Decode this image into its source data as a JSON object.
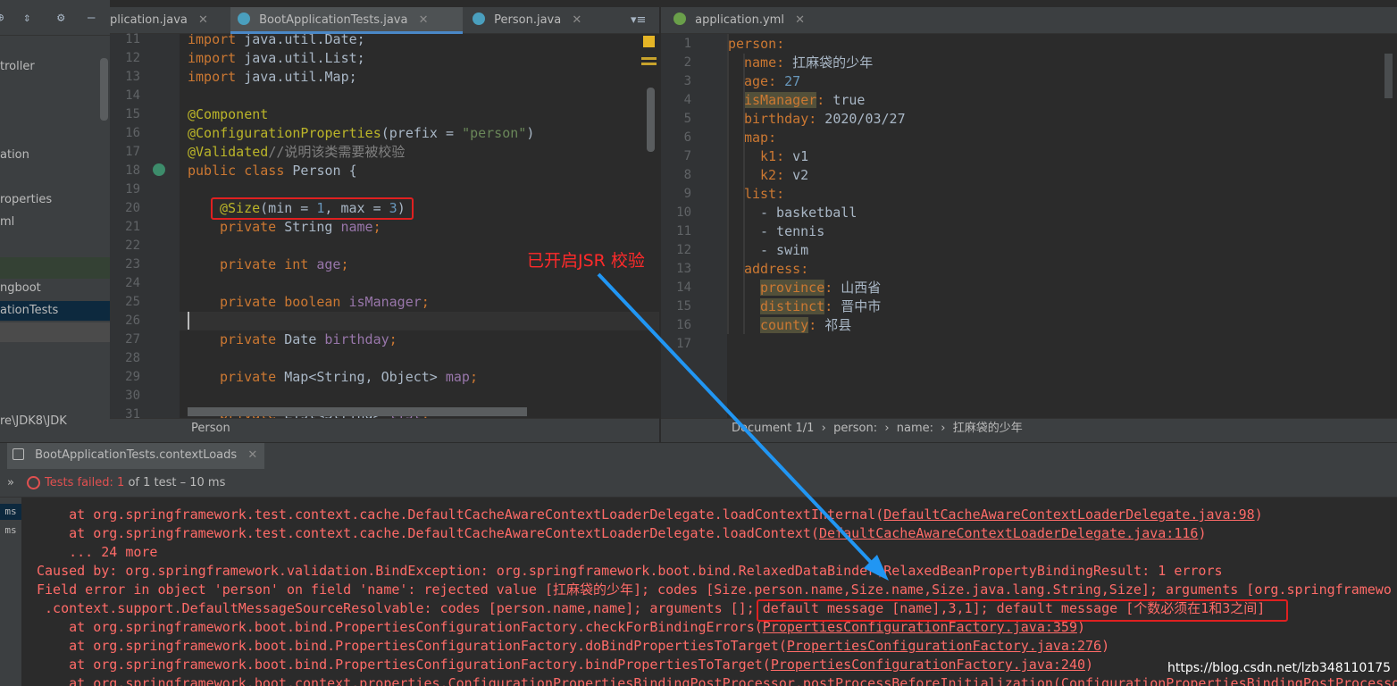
{
  "sidebar": {
    "items": [
      {
        "label": "troller"
      },
      {
        "label": "ation"
      },
      {
        "label": "roperties"
      },
      {
        "label": "ml"
      },
      {
        "label": "ngboot"
      },
      {
        "label": "ationTests"
      },
      {
        "label": "re\\JDK8\\JDK"
      }
    ]
  },
  "java_tabs": [
    {
      "label": "plication.java",
      "close": "✕"
    },
    {
      "label": "BootApplicationTests.java",
      "close": "✕"
    },
    {
      "label": "Person.java",
      "close": "✕"
    }
  ],
  "yml_tab": {
    "label": "application.yml",
    "close": "✕"
  },
  "java_lines": {
    "numbers": [
      "11",
      "12",
      "13",
      "14",
      "15",
      "16",
      "17",
      "18",
      "19",
      "20",
      "21",
      "22",
      "23",
      "24",
      "25",
      "26",
      "27",
      "28",
      "29",
      "30",
      "31"
    ]
  },
  "java_code": {
    "l11a": "import",
    "l11b": " java.util.Date;",
    "l12a": "import",
    "l12b": " java.util.List;",
    "l13a": "import",
    "l13b": " java.util.Map;",
    "l15": "@Component",
    "l16a": "@ConfigurationProperties",
    "l16b": "(prefix = ",
    "l16c": "\"person\"",
    "l16d": ")",
    "l17a": "@Validated",
    "l17b": "//说明该类需要被校验",
    "l18a": "public class",
    "l18b": " Person {",
    "l20a": "@Size",
    "l20b": "(min = ",
    "l20c": "1",
    "l20d": ", max = ",
    "l20e": "3",
    "l20f": ")",
    "l21a": "private",
    "l21b": " String ",
    "l21c": "name",
    "l21d": ";",
    "l23a": "private int",
    "l23b": " age",
    "l23c": ";",
    "l25a": "private boolean",
    "l25b": " isManager",
    "l25c": ";",
    "l27a": "private",
    "l27b": " Date ",
    "l27c": "birthday",
    "l27d": ";",
    "l29a": "private",
    "l29b": " Map<String, Object> ",
    "l29c": "map",
    "l29d": ";",
    "l31a": "private",
    "l31b": " List<String> ",
    "l31c": "list",
    "l31d": ";"
  },
  "java_breadcrumb": "Person",
  "yml_lines": {
    "numbers": [
      "1",
      "2",
      "3",
      "4",
      "5",
      "6",
      "7",
      "8",
      "9",
      "10",
      "11",
      "12",
      "13",
      "14",
      "15",
      "16",
      "17"
    ]
  },
  "yml_code": {
    "l1": "person",
    "colon": ":",
    "l2k": "name",
    "l2v": " 扛麻袋的少年",
    "l3k": "age",
    "l3v": " 27",
    "l4k": "isManager",
    "l4v": " true",
    "l5k": "birthday",
    "l5v": " 2020/03/27",
    "l6k": "map",
    "l7k": "k1",
    "l7v": " v1",
    "l8k": "k2",
    "l8v": " v2",
    "l9k": "list",
    "l10": "- basketball",
    "l11": "- tennis",
    "l12": "- swim",
    "l13k": "address",
    "l14k": "province",
    "l14v": " 山西省",
    "l15k": "distinct",
    "l15v": " 晋中市",
    "l16k": "county",
    "l16v": " 祁县"
  },
  "yml_breadcrumb": "Document 1/1  ›  person:  ›  name:  ›  扛麻袋的少年",
  "run": {
    "tab_label": "BootApplicationTests.contextLoads",
    "tab_close": "✕",
    "status_prefix": "Tests failed: ",
    "status_count": "1",
    "status_suffix": " of 1 test – 10 ms",
    "left_items": [
      "ms",
      "ms"
    ]
  },
  "console": {
    "l1a": "    at org.springframework.test.context.cache.DefaultCacheAwareContextLoaderDelegate.loadContextInternal(",
    "l1b": "DefaultCacheAwareContextLoaderDelegate.java:98",
    "l1c": ")",
    "l2a": "    at org.springframework.test.context.cache.DefaultCacheAwareContextLoaderDelegate.loadContext(",
    "l2b": "DefaultCacheAwareContextLoaderDelegate.java:116",
    "l2c": ")",
    "l3": "    ... 24 more",
    "l4": "Caused by: org.springframework.validation.BindException: org.springframework.boot.bind.RelaxedDataBinder$RelaxedBeanPropertyBindingResult: 1 errors",
    "l5": "Field error in object 'person' on field 'name': rejected value [扛麻袋的少年]; codes [Size.person.name,Size.name,Size.java.lang.String,Size]; arguments [org.springframewo",
    "l6a": " .context.support.DefaultMessageSourceResolvable: codes [person.name,name]; arguments []; ",
    "l6b": "default message [name],3,1]; default message [个数必须在1和3之间]",
    "l7a": "    at org.springframework.boot.bind.PropertiesConfigurationFactory.checkForBindingErrors(",
    "l7b": "PropertiesConfigurationFactory.java:359",
    "l7c": ")",
    "l8a": "    at org.springframework.boot.bind.PropertiesConfigurationFactory.doBindPropertiesToTarget(",
    "l8b": "PropertiesConfigurationFactory.java:276",
    "l8c": ")",
    "l9a": "    at org.springframework.boot.bind.PropertiesConfigurationFactory.bindPropertiesToTarget(",
    "l9b": "PropertiesConfigurationFactory.java:240",
    "l9c": ")",
    "l10": "    at org.springframework.boot.context.properties.ConfigurationPropertiesBindingPostProcessor.postProcessBeforeInitialization(ConfigurationPropertiesBindingPostProcessor"
  },
  "annotation": {
    "note": "已开启JSR 校验",
    "arrow_color": "#2196f3",
    "box_color": "#e02020"
  },
  "watermark": "https://blog.csdn.net/lzb348110175"
}
